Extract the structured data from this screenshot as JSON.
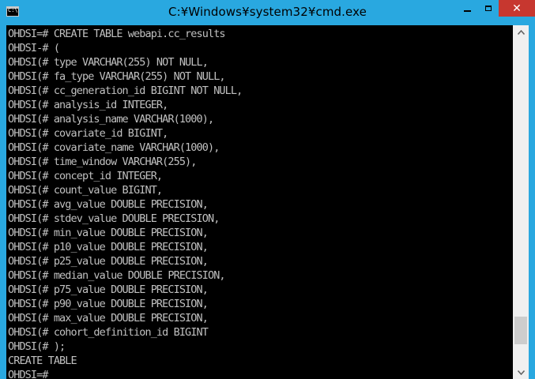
{
  "window": {
    "title": "C:¥Windows¥system32¥cmd.exe",
    "icon_name": "cmd-prompt-icon",
    "icon_text": "C:\\",
    "accent_color": "#29a8e0",
    "close_color": "#c7372f",
    "buttons": {
      "minimize_icon": "minimize-icon",
      "maximize_icon": "maximize-icon",
      "close_icon": "close-icon",
      "close_glyph": "✕"
    }
  },
  "console": {
    "background": "#000000",
    "text_color": "#c0c0c0",
    "lines": [
      "OHDSI=# CREATE TABLE webapi.cc_results",
      "OHDSI-# (",
      "OHDSI(# type VARCHAR(255) NOT NULL,",
      "OHDSI(# fa_type VARCHAR(255) NOT NULL,",
      "OHDSI(# cc_generation_id BIGINT NOT NULL,",
      "OHDSI(# analysis_id INTEGER,",
      "OHDSI(# analysis_name VARCHAR(1000),",
      "OHDSI(# covariate_id BIGINT,",
      "OHDSI(# covariate_name VARCHAR(1000),",
      "OHDSI(# time_window VARCHAR(255),",
      "OHDSI(# concept_id INTEGER,",
      "OHDSI(# count_value BIGINT,",
      "OHDSI(# avg_value DOUBLE PRECISION,",
      "OHDSI(# stdev_value DOUBLE PRECISION,",
      "OHDSI(# min_value DOUBLE PRECISION,",
      "OHDSI(# p10_value DOUBLE PRECISION,",
      "OHDSI(# p25_value DOUBLE PRECISION,",
      "OHDSI(# median_value DOUBLE PRECISION,",
      "OHDSI(# p75_value DOUBLE PRECISION,",
      "OHDSI(# p90_value DOUBLE PRECISION,",
      "OHDSI(# max_value DOUBLE PRECISION,",
      "OHDSI(# cohort_definition_id BIGINT",
      "OHDSI(# );",
      "CREATE TABLE",
      "OHDSI=#"
    ]
  },
  "scrollbar": {
    "up_icon": "scroll-up-arrow-icon",
    "down_icon": "scroll-down-arrow-icon",
    "position_fraction": 0.93
  }
}
